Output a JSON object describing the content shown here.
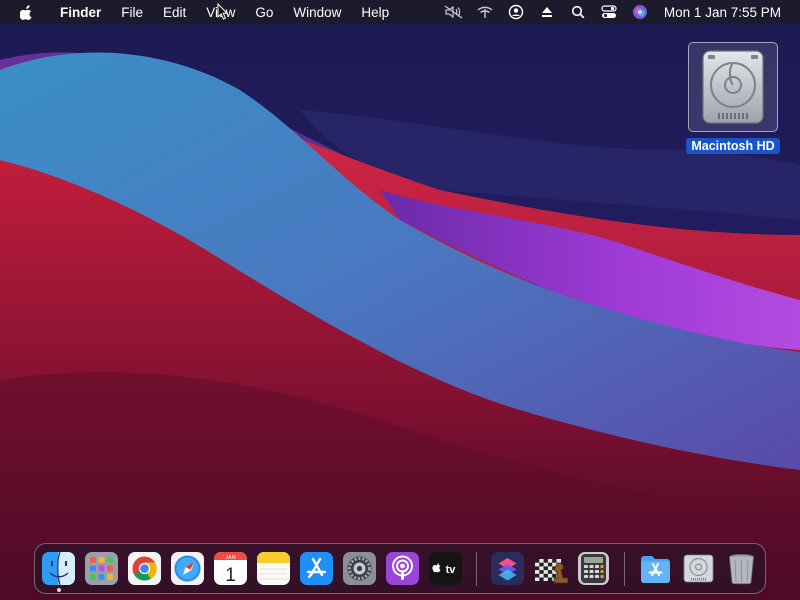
{
  "menubar": {
    "apple_icon": "apple-logo",
    "items": [
      "Finder",
      "File",
      "Edit",
      "View",
      "Go",
      "Window",
      "Help"
    ],
    "status_icons": [
      "audio-muted-icon",
      "wifi-icon",
      "user-icon",
      "eject-icon",
      "search-icon",
      "control-center-icon",
      "siri-icon"
    ],
    "clock": "Mon 1 Jan  7:55 PM"
  },
  "desktop": {
    "icons": [
      {
        "label": "Macintosh HD",
        "icon": "hard-drive-icon",
        "selected": true
      }
    ]
  },
  "dock": {
    "apps": [
      {
        "name": "Finder",
        "icon": "finder-icon",
        "running": true
      },
      {
        "name": "Launchpad",
        "icon": "launchpad-icon"
      },
      {
        "name": "Google Chrome",
        "icon": "chrome-icon"
      },
      {
        "name": "Safari",
        "icon": "safari-icon"
      },
      {
        "name": "Calendar",
        "icon": "calendar-icon",
        "month": "JAN",
        "day": "1"
      },
      {
        "name": "Notes",
        "icon": "notes-icon"
      },
      {
        "name": "App Store",
        "icon": "app-store-icon"
      },
      {
        "name": "System Preferences",
        "icon": "settings-icon"
      },
      {
        "name": "Podcasts",
        "icon": "podcasts-icon"
      },
      {
        "name": "TV",
        "icon": "apple-tv-icon",
        "label": "tv"
      },
      {
        "name": "Shortcuts",
        "icon": "shortcuts-icon"
      },
      {
        "name": "Chess",
        "icon": "chess-icon"
      },
      {
        "name": "Calculator",
        "icon": "calculator-icon"
      },
      {
        "name": "Applications",
        "icon": "app-store-folder-icon"
      },
      {
        "name": "Macintosh HD",
        "icon": "hard-drive-icon"
      },
      {
        "name": "Trash",
        "icon": "trash-icon"
      }
    ]
  }
}
